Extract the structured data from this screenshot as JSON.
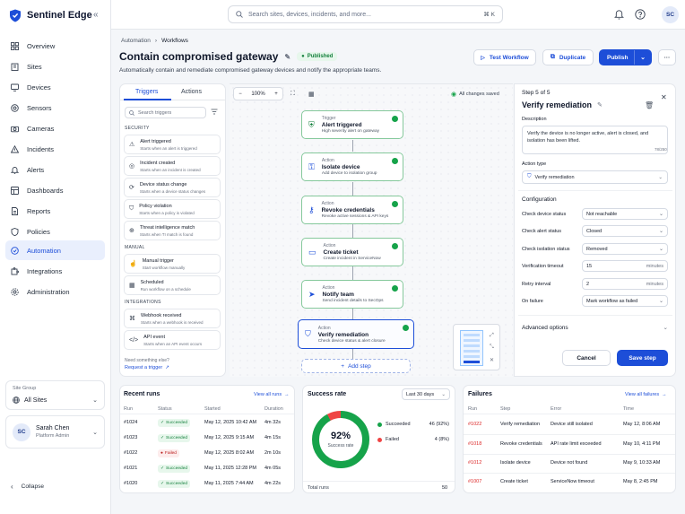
{
  "brand": {
    "name": "Sentinel Edge"
  },
  "search": {
    "placeholder": "Search sites, devices, incidents, and more...",
    "shortcut": "⌘ K"
  },
  "topbar": {
    "avatar": "SC"
  },
  "sidebar": {
    "items": [
      {
        "label": "Overview"
      },
      {
        "label": "Sites"
      },
      {
        "label": "Devices"
      },
      {
        "label": "Sensors"
      },
      {
        "label": "Cameras"
      },
      {
        "label": "Incidents"
      },
      {
        "label": "Alerts"
      },
      {
        "label": "Dashboards"
      },
      {
        "label": "Reports"
      },
      {
        "label": "Policies"
      },
      {
        "label": "Automation"
      },
      {
        "label": "Integrations"
      },
      {
        "label": "Administration"
      }
    ],
    "site_group_caption": "Site Group",
    "site_group_value": "All Sites",
    "user_name": "Sarah Chen",
    "user_role": "Platform Admin",
    "user_initials": "SC",
    "collapse_label": "Collapse"
  },
  "breadcrumb": {
    "parent": "Automation",
    "current": "Workflows"
  },
  "page": {
    "title": "Contain compromised gateway",
    "status": "Published",
    "subtitle": "Automatically contain and remediate compromised gateway devices and notify the appropriate teams."
  },
  "actions": {
    "test": "Test Workflow",
    "duplicate": "Duplicate",
    "publish": "Publish"
  },
  "left_panel": {
    "tabs": [
      "Triggers",
      "Actions"
    ],
    "search_placeholder": "Search triggers",
    "sections": {
      "security": "SECURITY",
      "manual": "MANUAL",
      "integrations": "INTEGRATIONS"
    },
    "security_triggers": [
      {
        "title": "Alert triggered",
        "desc": "Starts when an alert is triggered"
      },
      {
        "title": "Incident created",
        "desc": "Starts when an incident is created"
      },
      {
        "title": "Device status change",
        "desc": "Starts when a device status changes"
      },
      {
        "title": "Policy violation",
        "desc": "Starts when a policy is violated"
      },
      {
        "title": "Threat intelligence match",
        "desc": "Starts when TI match is found"
      }
    ],
    "manual_triggers": [
      {
        "title": "Manual trigger",
        "desc": "Start workflow manually"
      },
      {
        "title": "Scheduled",
        "desc": "Run workflow on a schedule"
      }
    ],
    "integration_triggers": [
      {
        "title": "Webhook received",
        "desc": "Starts when a webhook is received"
      },
      {
        "title": "API event",
        "desc": "Starts when an API event occurs"
      }
    ],
    "need_more": "Need something else?",
    "request_link": "Request a trigger"
  },
  "canvas": {
    "zoom": "100%",
    "saved": "All changes saved",
    "add_step": "Add step",
    "nodes": [
      {
        "kind": "Trigger",
        "name": "Alert triggered",
        "desc": "High severity alert on gateway"
      },
      {
        "kind": "Action",
        "name": "Isolate device",
        "desc": "Add device to isolation group"
      },
      {
        "kind": "Action",
        "name": "Revoke credentials",
        "desc": "Revoke active sessions & API keys"
      },
      {
        "kind": "Action",
        "name": "Create ticket",
        "desc": "Create incident in ServiceNow"
      },
      {
        "kind": "Action",
        "name": "Notify team",
        "desc": "Send incident details to SecOps"
      },
      {
        "kind": "Action",
        "name": "Verify remediation",
        "desc": "Check device status & alert closure"
      }
    ]
  },
  "step_panel": {
    "step_label": "Step 5 of 5",
    "title": "Verify remediation",
    "description_label": "Description",
    "description": "Verify the device is no longer active, alert is closed, and isolation has been lifted.",
    "char_count": "78/250",
    "action_type_label": "Action type",
    "action_type": "Verify remediation",
    "configuration_label": "Configuration",
    "fields": [
      {
        "label": "Check device status",
        "value": "Not reachable",
        "unit": ""
      },
      {
        "label": "Check alert status",
        "value": "Closed",
        "unit": ""
      },
      {
        "label": "Check isolation status",
        "value": "Removed",
        "unit": ""
      },
      {
        "label": "Verification timeout",
        "value": "15",
        "unit": "minutes"
      },
      {
        "label": "Retry interval",
        "value": "2",
        "unit": "minutes"
      },
      {
        "label": "On failure",
        "value": "Mark workflow as failed",
        "unit": ""
      }
    ],
    "advanced": "Advanced options",
    "cancel": "Cancel",
    "save": "Save step"
  },
  "recent_runs": {
    "title": "Recent runs",
    "view_all": "View all runs",
    "headers": [
      "Run",
      "Status",
      "Started",
      "Duration"
    ],
    "rows": [
      {
        "run": "#1024",
        "status": "Succeeded",
        "started": "May 12, 2025 10:42 AM",
        "duration": "4m 32s"
      },
      {
        "run": "#1023",
        "status": "Succeeded",
        "started": "May 12, 2025 9:15 AM",
        "duration": "4m 15s"
      },
      {
        "run": "#1022",
        "status": "Failed",
        "started": "May 12, 2025 8:02 AM",
        "duration": "2m 10s"
      },
      {
        "run": "#1021",
        "status": "Succeeded",
        "started": "May 11, 2025 12:28 PM",
        "duration": "4m 05s"
      },
      {
        "run": "#1020",
        "status": "Succeeded",
        "started": "May 11, 2025 7:44 AM",
        "duration": "4m 22s"
      }
    ]
  },
  "success_rate": {
    "title": "Success rate",
    "range": "Last 30 days",
    "percent": "92%",
    "percent_value": 92,
    "caption": "Success rate",
    "succeeded_label": "Succeeded",
    "succeeded_value": "46 (92%)",
    "failed_label": "Failed",
    "failed_value": "4 (8%)",
    "total_label": "Total runs",
    "total_value": "50",
    "colors": {
      "succeeded": "#16a34a",
      "failed": "#ef4444"
    }
  },
  "failures": {
    "title": "Failures",
    "view_all": "View all failures",
    "headers": [
      "Run",
      "Step",
      "Error",
      "Time"
    ],
    "rows": [
      {
        "run": "#1022",
        "step": "Verify remediation",
        "error": "Device still isolated",
        "time": "May 12, 8:06 AM"
      },
      {
        "run": "#1018",
        "step": "Revoke credentials",
        "error": "API rate limit exceeded",
        "time": "May 10, 4:11 PM"
      },
      {
        "run": "#1012",
        "step": "Isolate device",
        "error": "Device not found",
        "time": "May 9, 10:33 AM"
      },
      {
        "run": "#1007",
        "step": "Create ticket",
        "error": "ServiceNow timeout",
        "time": "May 8, 2:45 PM"
      }
    ]
  }
}
